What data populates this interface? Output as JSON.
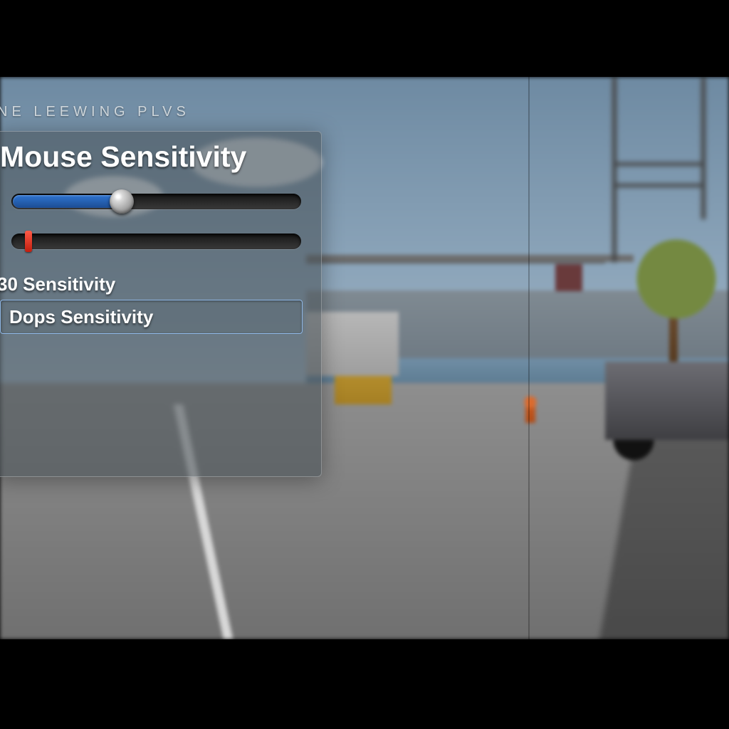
{
  "watermark": "NE LEEWING PLVS",
  "panel": {
    "title": "Mouse Sensitivity",
    "slider1": {
      "percent": 38
    },
    "slider2": {
      "percent": 6
    },
    "sub_label": "30 Sensitivity",
    "dropdown_value": "Dops Sensitivity"
  },
  "colors": {
    "slider_fill": "#2f74d0",
    "tick_red": "#ff5a47",
    "select_border": "#8fb7e6"
  }
}
